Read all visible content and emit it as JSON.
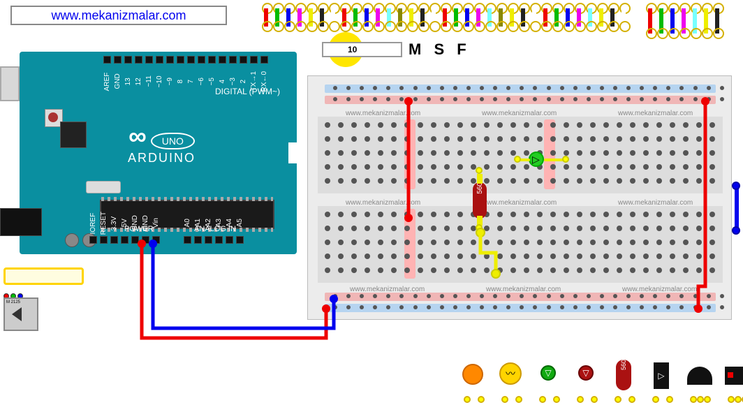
{
  "site_url": "www.mekanizmalar.com",
  "arduino": {
    "name": "ARDUINO",
    "model": "UNO",
    "digital_label": "DIGITAL (PWM~)",
    "power_label": "POWER",
    "analog_label": "ANALOG IN",
    "top_pins": [
      "AREF",
      "GND",
      "13",
      "12",
      "~11",
      "~10",
      "~9",
      "8",
      "7",
      "~6",
      "~5",
      "4",
      "~3",
      "2",
      "TX→1",
      "RX←0"
    ],
    "bot_pins_power": [
      "IOREF",
      "RESET",
      "3.3V",
      "5V",
      "GND",
      "GND",
      "Vin"
    ],
    "bot_pins_analog": [
      "A0",
      "A1",
      "A2",
      "A3",
      "A4",
      "A5"
    ]
  },
  "speed": {
    "value": "10",
    "labels": "M S F"
  },
  "watermark": "www.mekanizmalar.com",
  "wire_colors": [
    "#e00",
    "#0b0",
    "#00e",
    "#e0e",
    "#ee0",
    "#222",
    "#fff",
    "#e00",
    "#0b0",
    "#00e",
    "#e0e",
    "#7ff",
    "#880",
    "#ee0",
    "#222",
    "#fff",
    "#e00",
    "#0b0",
    "#00e",
    "#e0e",
    "#7ff",
    "#880",
    "#ee0",
    "#222",
    "#fff",
    "#e00",
    "#0b0",
    "#00e",
    "#e0e",
    "#7ff",
    "#ee0",
    "#222",
    "#fff"
  ],
  "wire_colors2": [
    "#e00",
    "#0b0",
    "#00e",
    "#e0e",
    "#7ff",
    "#ee0",
    "#222"
  ],
  "resistor_value": "560",
  "palette_resistor": "560",
  "mini_label": "M 2125"
}
